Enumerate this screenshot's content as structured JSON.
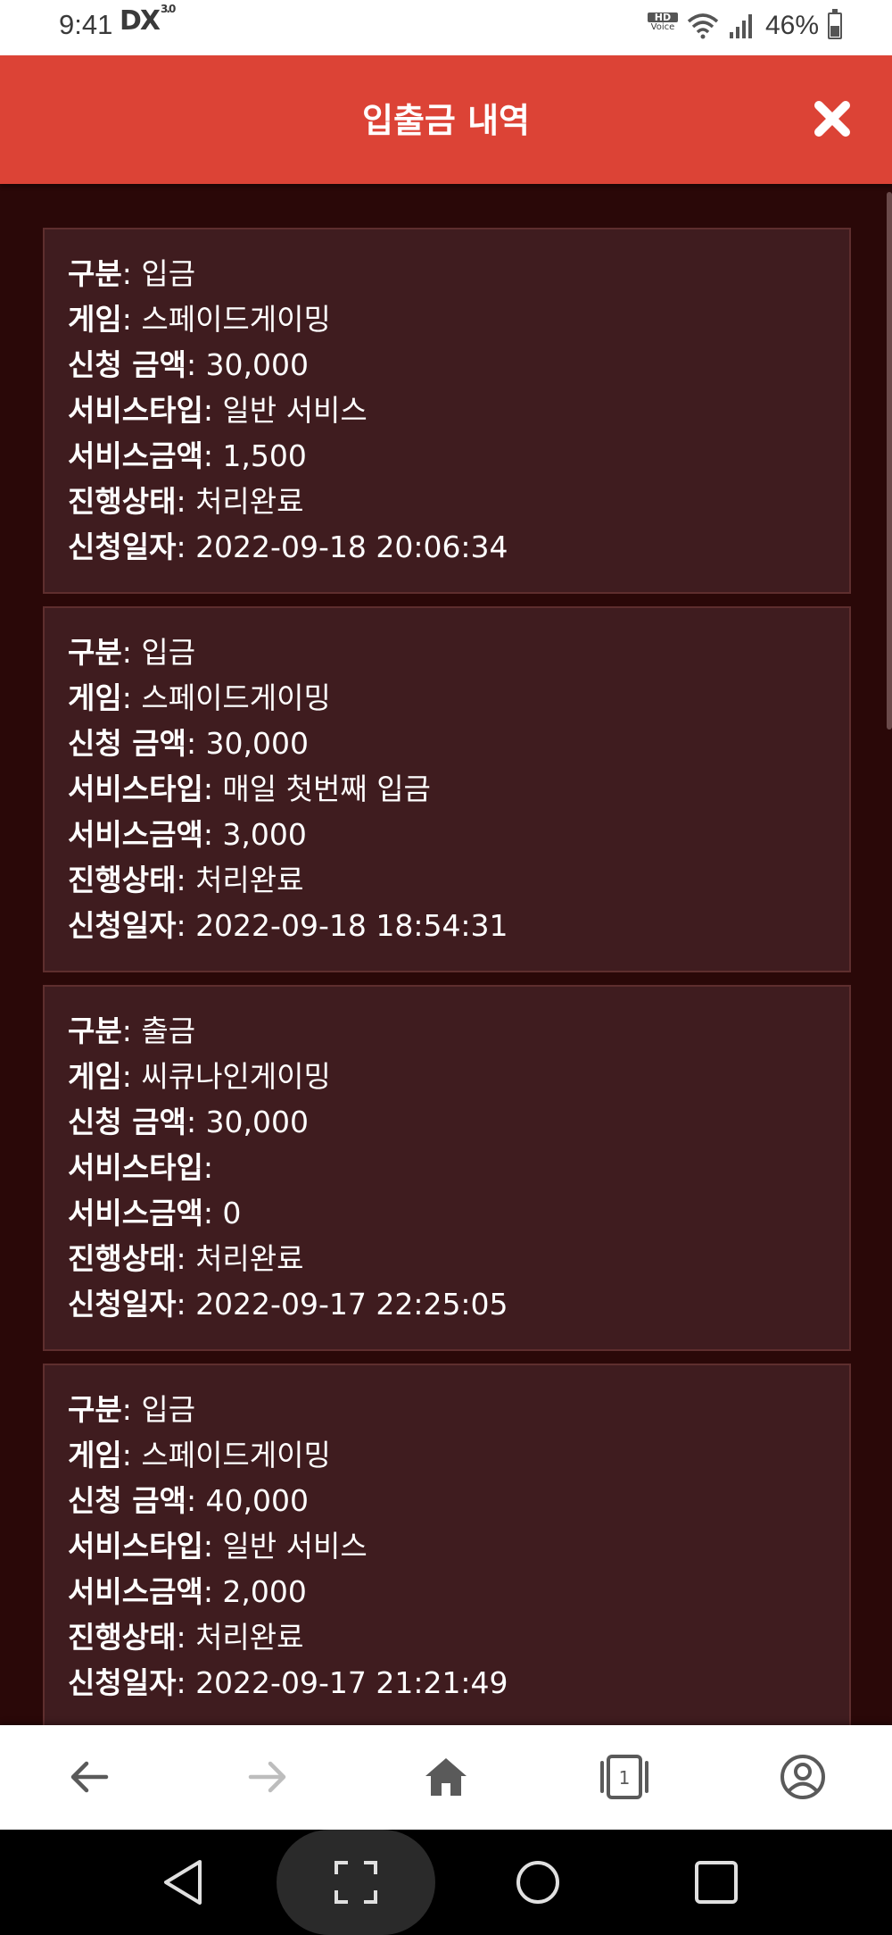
{
  "status_bar": {
    "time": "9:41",
    "dx_label": "DX",
    "dx_version": "3.0",
    "hd_label": "HD",
    "voice_label": "Voice",
    "battery": "46%"
  },
  "header": {
    "title": "입출금 내역"
  },
  "labels": {
    "type": "구분",
    "game": "게임",
    "amount": "신청 금액",
    "service_type": "서비스타입",
    "service_amount": "서비스금액",
    "status": "진행상태",
    "date": "신청일자"
  },
  "records": [
    {
      "type": "입금",
      "game": "스페이드게이밍",
      "amount": "30,000",
      "service_type": "일반 서비스",
      "service_amount": "1,500",
      "status": "처리완료",
      "date": "2022-09-18 20:06:34"
    },
    {
      "type": "입금",
      "game": "스페이드게이밍",
      "amount": "30,000",
      "service_type": "매일 첫번째 입금",
      "service_amount": "3,000",
      "status": "처리완료",
      "date": "2022-09-18 18:54:31"
    },
    {
      "type": "출금",
      "game": "씨큐나인게이밍",
      "amount": "30,000",
      "service_type": "",
      "service_amount": "0",
      "status": "처리완료",
      "date": "2022-09-17 22:25:05"
    },
    {
      "type": "입금",
      "game": "스페이드게이밍",
      "amount": "40,000",
      "service_type": "일반 서비스",
      "service_amount": "2,000",
      "status": "처리완료",
      "date": "2022-09-17 21:21:49"
    }
  ],
  "bottom_nav": {
    "tabs_count": "1"
  },
  "colors": {
    "header": "#dc4336",
    "background": "#2a0808",
    "card": "#3f1c1f",
    "card_border": "#5e2e2e"
  }
}
